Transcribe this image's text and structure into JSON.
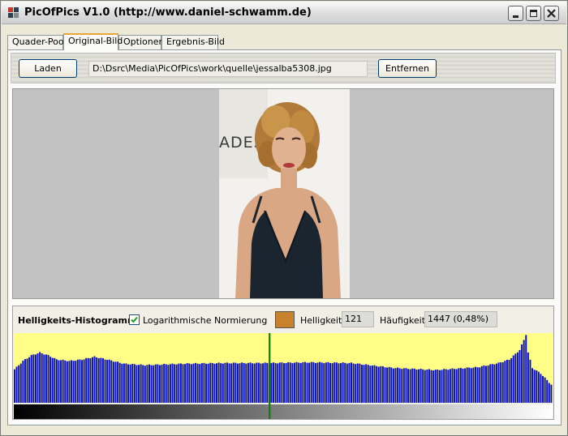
{
  "window": {
    "title": "PicOfPics V1.0 (http://www.daniel-schwamm.de)"
  },
  "tabs": [
    {
      "label": "Quader-Pool"
    },
    {
      "label": "Original-Bild",
      "active": true
    },
    {
      "label": "Optionen"
    },
    {
      "label": "Ergebnis-Bild"
    }
  ],
  "toolbar": {
    "load_label": "Laden",
    "path_value": "D:\\Dsrc\\Media\\PicOfPics\\work\\quelle\\jessalba5308.jpg",
    "remove_label": "Entfernen"
  },
  "histogram": {
    "title": "Helligkeits-Histogramm",
    "log_norm_label": "Logarithmische Normierung",
    "log_norm_checked": true,
    "swatch_color": "#c8822e",
    "brightness_label": "Helligkeit:",
    "brightness_value": "121",
    "frequency_label": "Häufigkeit:",
    "frequency_value": "1447 (0,48%)",
    "background_color": "#ffff88",
    "bar_color": "#0a10c8",
    "marker_color": "#0c7a0c",
    "selected_brightness": 121,
    "level_count": 256
  },
  "chart_data": {
    "type": "bar",
    "title": "Helligkeits-Histogramm",
    "xlabel": "",
    "ylabel": "",
    "xlim": [
      0,
      255
    ],
    "ylim": [
      0,
      1
    ],
    "keypoints": [
      [
        0,
        0.48
      ],
      [
        4,
        0.6
      ],
      [
        8,
        0.68
      ],
      [
        12,
        0.72
      ],
      [
        16,
        0.68
      ],
      [
        20,
        0.62
      ],
      [
        26,
        0.6
      ],
      [
        32,
        0.62
      ],
      [
        38,
        0.66
      ],
      [
        44,
        0.62
      ],
      [
        52,
        0.56
      ],
      [
        62,
        0.54
      ],
      [
        80,
        0.56
      ],
      [
        100,
        0.57
      ],
      [
        121,
        0.57
      ],
      [
        140,
        0.58
      ],
      [
        160,
        0.57
      ],
      [
        180,
        0.5
      ],
      [
        200,
        0.47
      ],
      [
        210,
        0.49
      ],
      [
        220,
        0.51
      ],
      [
        230,
        0.57
      ],
      [
        235,
        0.62
      ],
      [
        238,
        0.7
      ],
      [
        240,
        0.76
      ],
      [
        242,
        0.9
      ],
      [
        243,
        0.98
      ],
      [
        244,
        0.72
      ],
      [
        246,
        0.5
      ],
      [
        250,
        0.42
      ],
      [
        255,
        0.26
      ]
    ]
  }
}
